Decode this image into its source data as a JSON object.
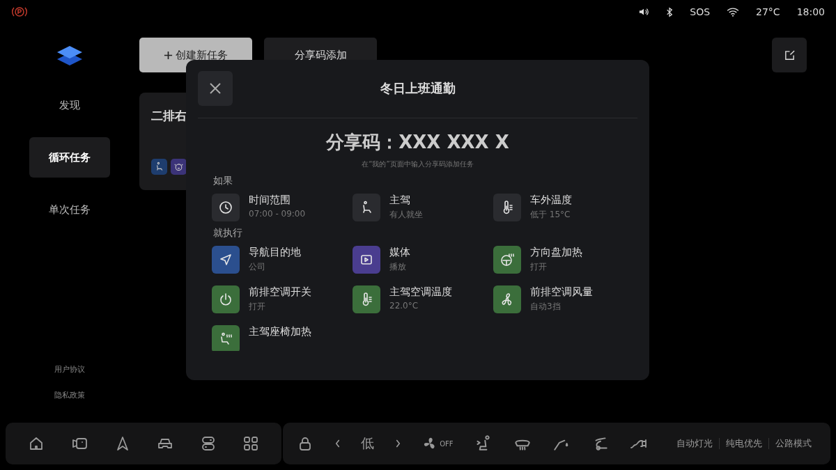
{
  "status_bar": {
    "sos": "SOS",
    "temperature": "27°C",
    "time": "18:00"
  },
  "sidebar": {
    "items": [
      {
        "label": "发现",
        "selected": false
      },
      {
        "label": "循环任务",
        "selected": true
      },
      {
        "label": "单次任务",
        "selected": false
      }
    ],
    "footer_links": [
      "用户协议",
      "隐私政策"
    ]
  },
  "top_actions": [
    {
      "label": "创建新任务",
      "kind": "primary"
    },
    {
      "label": "分享码添加",
      "kind": "secondary"
    }
  ],
  "task_card": {
    "title": "二排右",
    "icons": [
      {
        "kind": "seat",
        "color": "#1e3d6e"
      },
      {
        "kind": "massage",
        "color": "#3b3378"
      }
    ]
  },
  "modal": {
    "title": "冬日上班通勤",
    "share_code": "分享码：XXX XXX X",
    "hint": "在“我的”页面中输入分享码添加任务",
    "sections": [
      {
        "heading": "如果",
        "items": [
          {
            "kind": "clock",
            "title": "时间范围",
            "detail": "07:00 - 09:00",
            "color": "#2a2b2f"
          },
          {
            "kind": "seat",
            "title": "主驾",
            "detail": "有人就坐",
            "color": "#2a2b2f"
          },
          {
            "kind": "thermometer",
            "title": "车外温度",
            "detail": "低于 15°C",
            "color": "#2a2b2f"
          }
        ]
      },
      {
        "heading": "就执行",
        "items": [
          {
            "kind": "navigation",
            "title": "导航目的地",
            "detail": "公司",
            "color": "#2b4f8e"
          },
          {
            "kind": "media",
            "title": "媒体",
            "detail": "播放",
            "color": "#4a3d8f"
          },
          {
            "kind": "wheel-heat",
            "title": "方向盘加热",
            "detail": "打开",
            "color": "#3b6e3b"
          },
          {
            "kind": "power",
            "title": "前排空调开关",
            "detail": "打开",
            "color": "#3b6e3b"
          },
          {
            "kind": "thermometer",
            "title": "主驾空调温度",
            "detail": "22.0°C",
            "color": "#3b6e3b"
          },
          {
            "kind": "fan",
            "title": "前排空调风量",
            "detail": "自动3挡",
            "color": "#3b6e3b"
          },
          {
            "kind": "seat-heat",
            "title": "主驾座椅加热",
            "color": "#3b6e3b"
          }
        ]
      }
    ]
  },
  "dock": {
    "fan_speed": "低",
    "fan_state": "OFF",
    "toggles": [
      "自动灯光",
      "纯电优先",
      "公路模式"
    ]
  }
}
